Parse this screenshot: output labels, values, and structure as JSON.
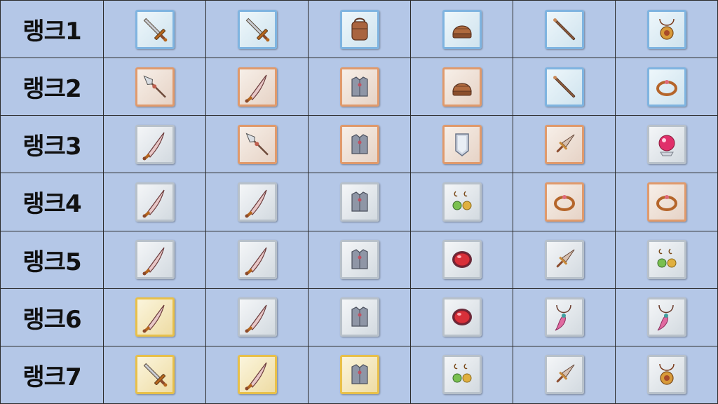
{
  "rows": [
    {
      "rank": "랭크1",
      "items": [
        {
          "icon": "sword-icon",
          "tier": "blue"
        },
        {
          "icon": "sword-icon",
          "tier": "blue"
        },
        {
          "icon": "backpack-armor-icon",
          "tier": "blue"
        },
        {
          "icon": "helmet-icon",
          "tier": "blue"
        },
        {
          "icon": "staff-icon",
          "tier": "blue"
        },
        {
          "icon": "amulet-icon",
          "tier": "blue"
        }
      ]
    },
    {
      "rank": "랭크2",
      "items": [
        {
          "icon": "spear-icon",
          "tier": "copper"
        },
        {
          "icon": "scimitar-icon",
          "tier": "copper"
        },
        {
          "icon": "chest-armor-icon",
          "tier": "copper"
        },
        {
          "icon": "helmet-icon",
          "tier": "copper"
        },
        {
          "icon": "staff-icon",
          "tier": "blue"
        },
        {
          "icon": "bracelet-icon",
          "tier": "blue"
        }
      ]
    },
    {
      "rank": "랭크3",
      "items": [
        {
          "icon": "scimitar-icon",
          "tier": "silver"
        },
        {
          "icon": "spear-icon",
          "tier": "copper"
        },
        {
          "icon": "chest-armor-icon",
          "tier": "copper"
        },
        {
          "icon": "shield-icon",
          "tier": "copper"
        },
        {
          "icon": "dagger-icon",
          "tier": "copper"
        },
        {
          "icon": "crystal-orb-icon",
          "tier": "silver"
        }
      ]
    },
    {
      "rank": "랭크4",
      "items": [
        {
          "icon": "scimitar-icon",
          "tier": "silver"
        },
        {
          "icon": "scimitar-icon",
          "tier": "silver"
        },
        {
          "icon": "chest-armor-icon",
          "tier": "silver"
        },
        {
          "icon": "earrings-icon",
          "tier": "silver"
        },
        {
          "icon": "bracelet-icon",
          "tier": "copper"
        },
        {
          "icon": "bracelet-icon",
          "tier": "copper"
        }
      ]
    },
    {
      "rank": "랭크5",
      "items": [
        {
          "icon": "scimitar-icon",
          "tier": "silver"
        },
        {
          "icon": "scimitar-icon",
          "tier": "silver"
        },
        {
          "icon": "chest-armor-icon",
          "tier": "silver"
        },
        {
          "icon": "gem-icon",
          "tier": "silver"
        },
        {
          "icon": "dagger-icon",
          "tier": "silver"
        },
        {
          "icon": "earrings-icon",
          "tier": "silver"
        }
      ]
    },
    {
      "rank": "랭크6",
      "items": [
        {
          "icon": "scimitar-icon",
          "tier": "gold"
        },
        {
          "icon": "scimitar-icon",
          "tier": "silver"
        },
        {
          "icon": "chest-armor-icon",
          "tier": "silver"
        },
        {
          "icon": "gem-icon",
          "tier": "silver"
        },
        {
          "icon": "feather-necklace-icon",
          "tier": "silver"
        },
        {
          "icon": "feather-necklace-icon",
          "tier": "silver"
        }
      ]
    },
    {
      "rank": "랭크7",
      "items": [
        {
          "icon": "sword-icon",
          "tier": "gold"
        },
        {
          "icon": "scimitar-icon",
          "tier": "gold"
        },
        {
          "icon": "chest-armor-icon",
          "tier": "gold"
        },
        {
          "icon": "earrings-icon",
          "tier": "silver"
        },
        {
          "icon": "dagger-icon",
          "tier": "silver"
        },
        {
          "icon": "amulet-icon",
          "tier": "silver"
        }
      ]
    }
  ]
}
